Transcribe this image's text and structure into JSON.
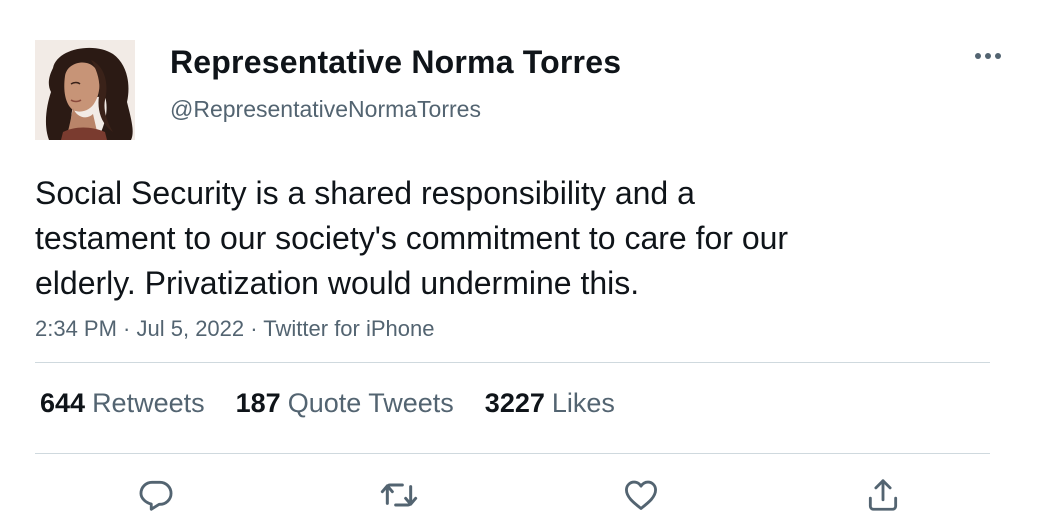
{
  "author": {
    "display_name": "Representative Norma Torres",
    "handle": "@RepresentativeNormaTorres"
  },
  "tweet": {
    "text_lines": [
      "Social Security is a shared responsibility and a",
      "testament to our society's commitment to care for our",
      "elderly. Privatization would undermine this."
    ],
    "time": "2:34 PM",
    "date": "Jul 5, 2022",
    "source": "Twitter for iPhone",
    "separator": " · "
  },
  "stats": {
    "retweets": {
      "count": "644",
      "label": "Retweets"
    },
    "quote_tweets": {
      "count": "187",
      "label": "Quote Tweets"
    },
    "likes": {
      "count": "3227",
      "label": "Likes"
    }
  },
  "icons": {
    "more": "more-horizontal-icon",
    "reply": "reply-icon",
    "retweet": "retweet-icon",
    "like": "heart-icon",
    "share": "share-icon"
  },
  "colors": {
    "text_primary": "#0f1419",
    "text_secondary": "#536471",
    "divider": "#cfd9de",
    "icon": "#536471"
  }
}
